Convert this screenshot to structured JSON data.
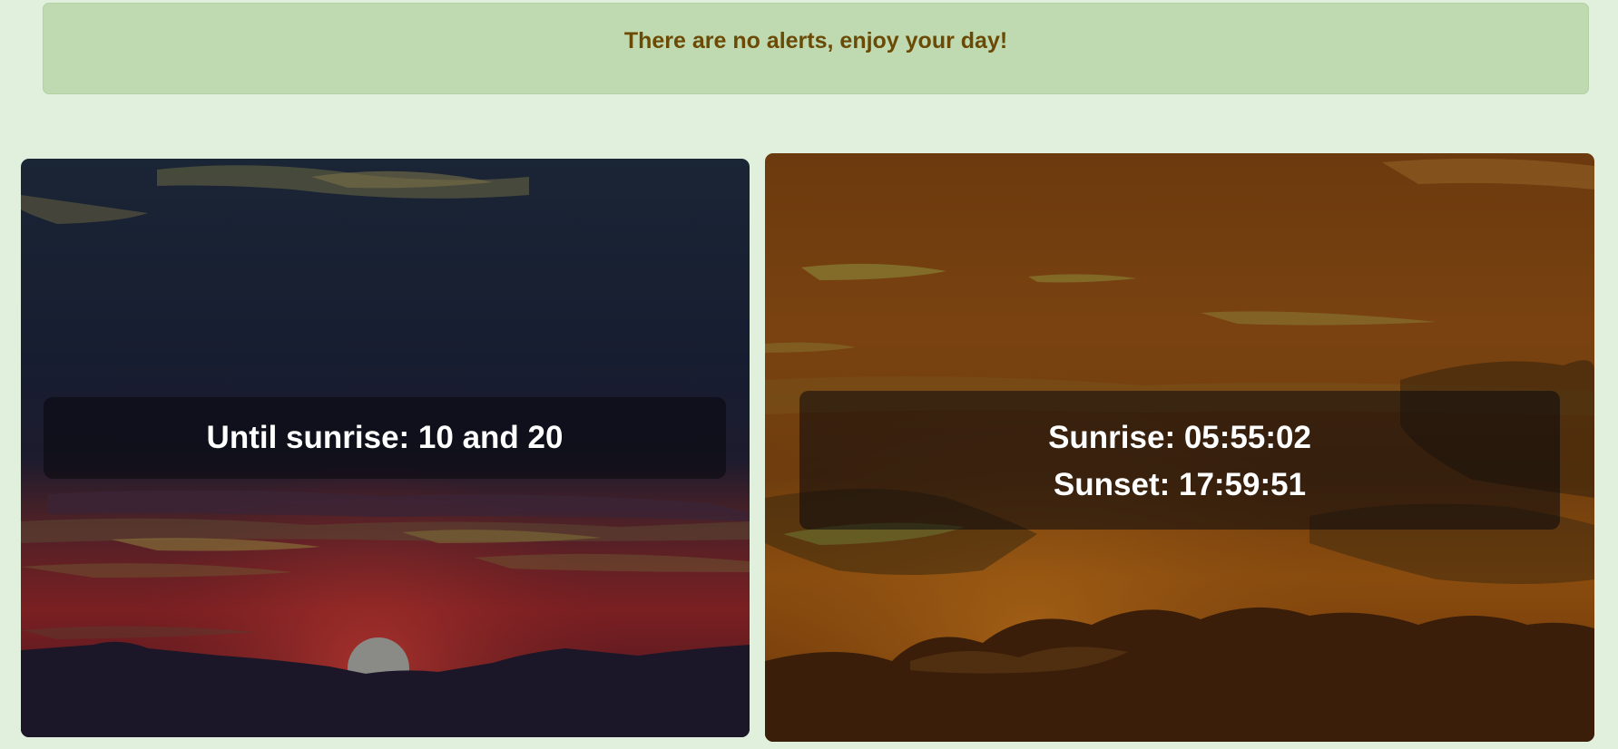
{
  "alert": {
    "message": "There are no alerts, enjoy your day!"
  },
  "countdown_card": {
    "text": "Until sunrise: 10 and 20"
  },
  "times_card": {
    "sunrise": "Sunrise: 05:55:02",
    "sunset": "Sunset: 17:59:51"
  },
  "colors": {
    "page_background": "#e1f0dc",
    "alert_background": "#bfd9b1",
    "alert_text": "#6b4a05"
  }
}
